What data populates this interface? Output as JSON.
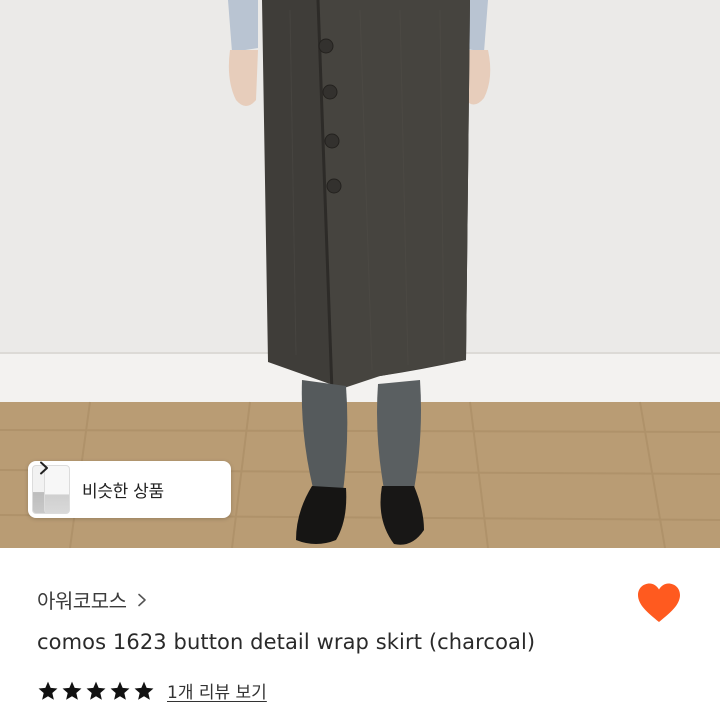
{
  "photo": {
    "subject": "model wearing charcoal wrap skirt"
  },
  "similar": {
    "label": "비슷한 상품",
    "chevron_icon": "chevron-right-icon"
  },
  "shop": {
    "name": "아워코모스",
    "chevron_icon": "chevron-right-icon"
  },
  "product": {
    "title": "comos 1623 button detail wrap skirt (charcoal)"
  },
  "rating": {
    "stars": 5,
    "star_icon": "star-icon",
    "review_link": "1개 리뷰 보기"
  },
  "favorite": {
    "icon": "heart-icon",
    "active": true,
    "color": "#ff5a1f"
  },
  "colors": {
    "accent": "#ff5a1f",
    "text_primary": "#2a2a2a",
    "star": "#111111"
  }
}
